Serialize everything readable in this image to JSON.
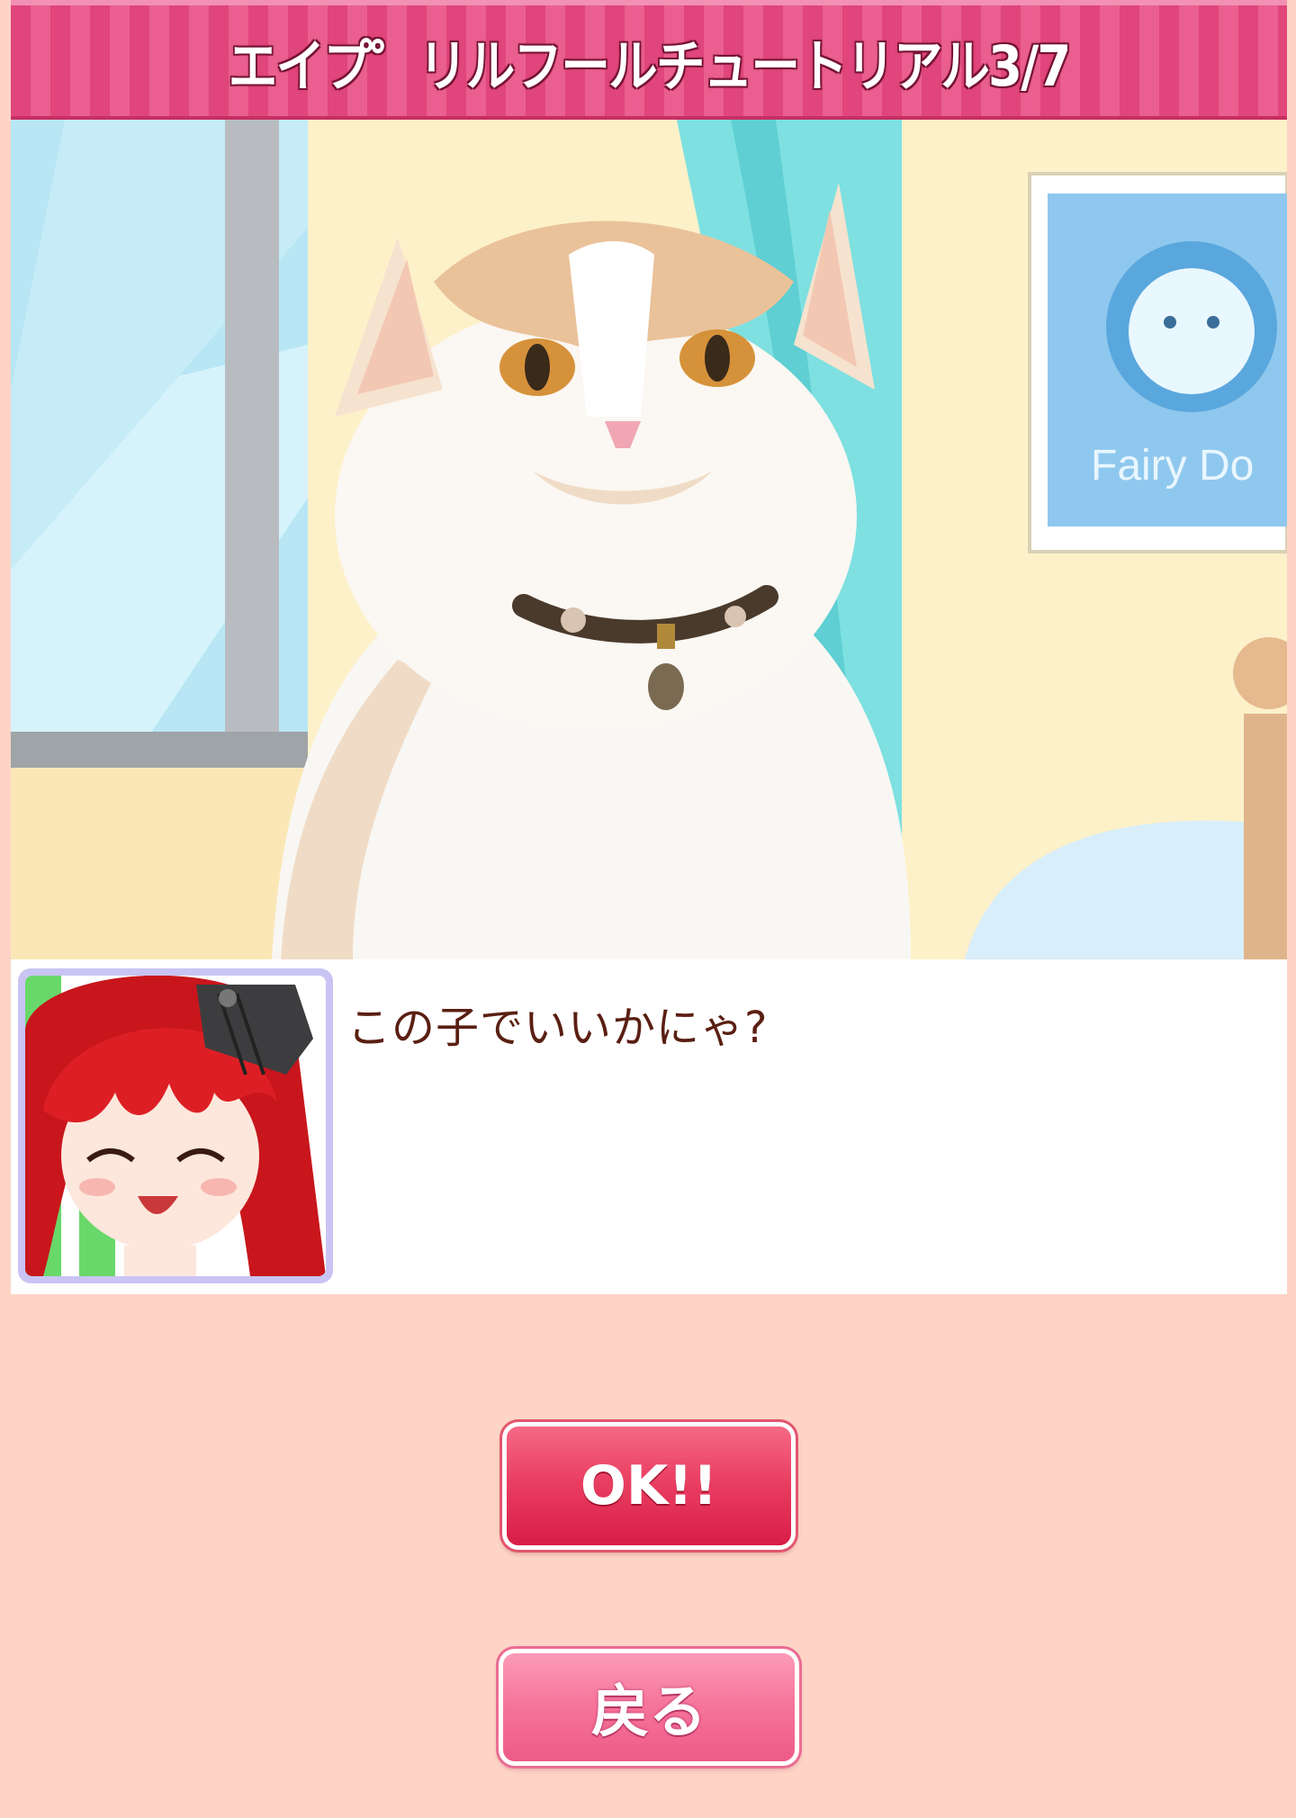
{
  "header": {
    "title": "エイプ゜リルフールチュートリアル3/7"
  },
  "scene": {
    "poster_text": "Fairy Do",
    "subject": "white-cat-with-collar"
  },
  "dialog": {
    "speaker_avatar": "red-haired-anime-girl-avatar",
    "message": "この子でいいかにゃ?"
  },
  "buttons": {
    "ok_label": "OK!!",
    "back_label": "戻る"
  },
  "colors": {
    "background": "#fdd4c6",
    "title_bar": "#e0457c",
    "ok_button": "#e23a5f",
    "back_button": "#f57399",
    "dialog_text": "#5a1f12"
  }
}
